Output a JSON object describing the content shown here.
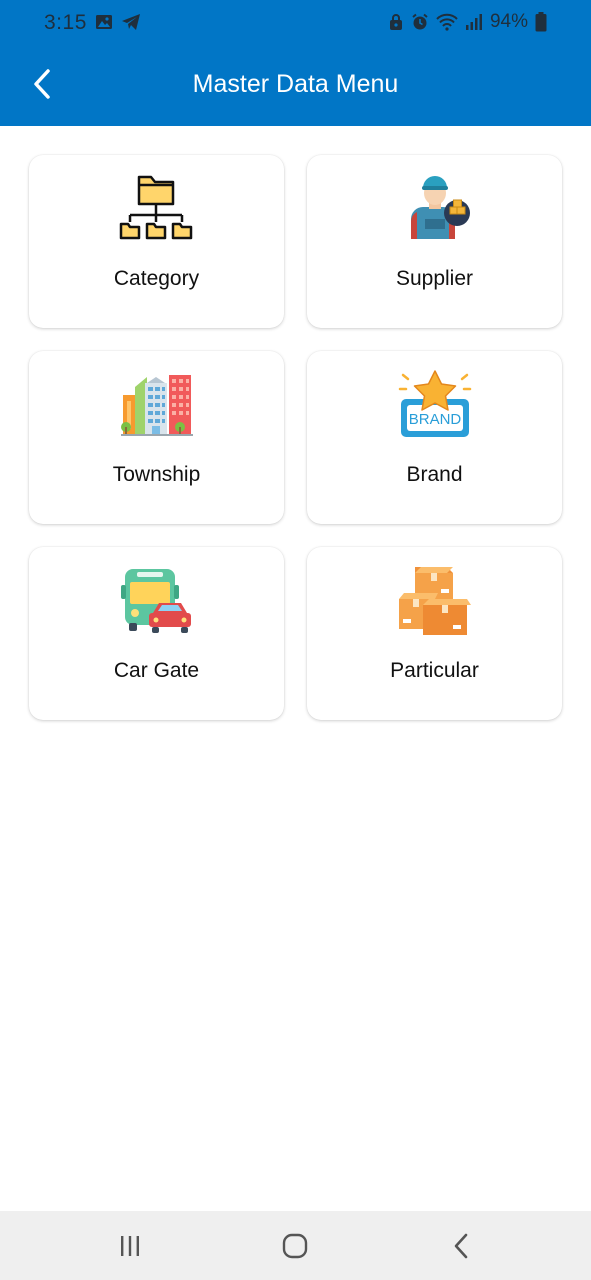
{
  "status_bar": {
    "time": "3:15",
    "battery": "94%",
    "icons_left": [
      "image-icon",
      "telegram-icon"
    ],
    "icons_right": [
      "lock-icon",
      "alarm-icon",
      "wifi-icon",
      "signal-icon",
      "battery-icon"
    ]
  },
  "header": {
    "title": "Master Data Menu",
    "background": "#0176c6"
  },
  "menu": {
    "items": [
      {
        "label": "Category",
        "icon": "folder-tree-icon"
      },
      {
        "label": "Supplier",
        "icon": "supplier-person-icon"
      },
      {
        "label": "Township",
        "icon": "buildings-icon"
      },
      {
        "label": "Brand",
        "icon": "brand-star-icon"
      },
      {
        "label": "Car Gate",
        "icon": "bus-car-icon"
      },
      {
        "label": "Particular",
        "icon": "boxes-icon"
      }
    ]
  },
  "system_nav": {
    "buttons": [
      "recent-apps-icon",
      "home-icon",
      "back-icon"
    ]
  }
}
